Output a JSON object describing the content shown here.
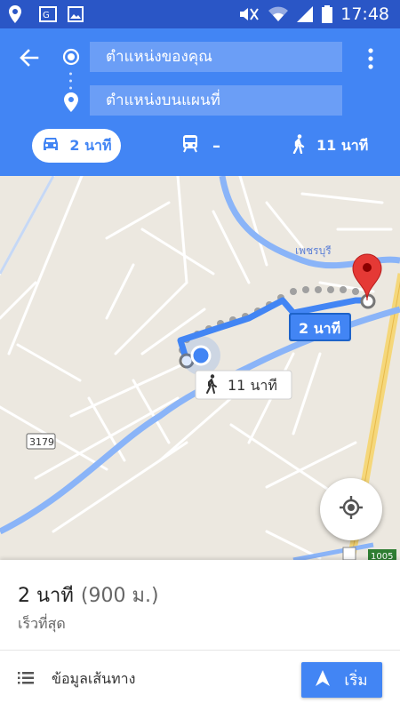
{
  "status_bar": {
    "time": "17:48",
    "left_icons": [
      "location-icon",
      "photo-icon",
      "gallery-icon"
    ],
    "right_icons": [
      "mute-icon",
      "wifi-icon",
      "signal-icon",
      "battery-icon"
    ]
  },
  "header": {
    "origin": "ตำแหน่งของคุณ",
    "destination": "ตำแหน่งบนแผนที่"
  },
  "modes": {
    "drive": "2 นาที",
    "transit": "–",
    "walk": "11 นาที"
  },
  "map": {
    "river_label": "เพชรบุรี",
    "road_shield": "3179",
    "highway_label": "1005",
    "drive_route_label": "2 นาที",
    "walk_route_label": "11 นาที",
    "colors": {
      "route": "#4285f4",
      "land": "#ece8e0",
      "water": "#8ab4f8",
      "highway": "#f5d77a",
      "destination_pin": "#e53935"
    }
  },
  "panel": {
    "duration": "2 นาที",
    "distance": "(900 ม.)",
    "subtitle": "เร็วที่สุด",
    "steps_label": "ข้อมูลเส้นทาง",
    "start_label": "เริ่ม"
  }
}
